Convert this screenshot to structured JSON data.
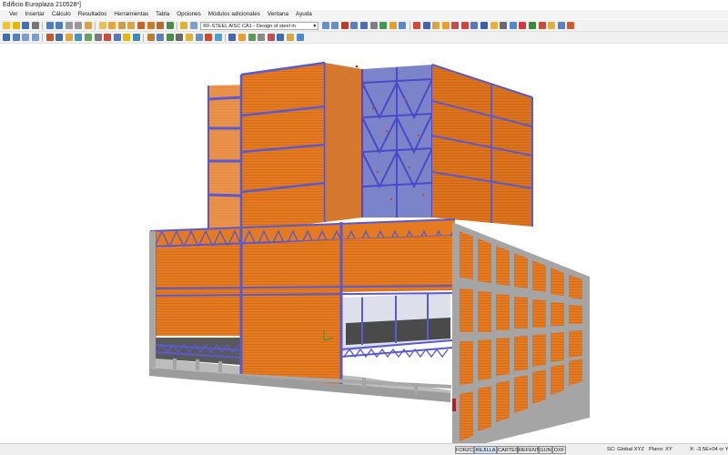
{
  "window": {
    "title": "Edificio Europlaza 210528*]"
  },
  "menu": {
    "items": [
      "Ver",
      "Insertar",
      "Cálculo",
      "Resultados",
      "Herramientas",
      "Tabla",
      "Opciones",
      "Módulos adicionales",
      "Ventana",
      "Ayuda"
    ]
  },
  "toolbar": {
    "module_selector": "RF-STEEL AISC CA1 - Design of steel m"
  },
  "statusbar": {
    "buttons": [
      "FORZC",
      "REJILLA",
      "CARTES",
      "REFENT",
      "GUN",
      "DXF"
    ],
    "active_button": "REJILLA",
    "coord_system": "SC: Global XYZ",
    "plane": "Plano: XY",
    "coordinate_readout": "X: -3.5E+04 cr Y:"
  },
  "colors": {
    "cladding_orange": "#e57a1e",
    "steel_blue": "#5a5ad0",
    "concrete_grey": "#a5a5a5",
    "floor_dark": "#4a4a4a"
  },
  "icons": [
    "new-file-icon",
    "open-icon",
    "save-icon",
    "print-icon",
    "undo-icon",
    "redo-icon",
    "cut-icon",
    "copy-icon",
    "paste-icon",
    "zoom-icon",
    "render-icon",
    "grid-icon",
    "view-iso-icon",
    "view-front-icon",
    "view-top-icon",
    "select-icon",
    "node-icon",
    "member-icon",
    "support-icon",
    "load-icon"
  ]
}
